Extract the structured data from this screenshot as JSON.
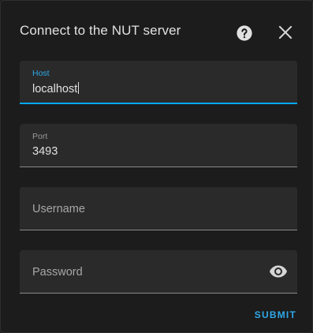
{
  "dialog": {
    "title": "Connect to the NUT server",
    "help_icon": "help-circle-icon",
    "close_icon": "close-icon"
  },
  "fields": {
    "host": {
      "label": "Host",
      "value": "localhost"
    },
    "port": {
      "label": "Port",
      "value": "3493"
    },
    "username": {
      "label": "Username",
      "value": ""
    },
    "password": {
      "label": "Password",
      "value": "",
      "toggle_icon": "eye-icon"
    }
  },
  "actions": {
    "submit_label": "SUBMIT"
  },
  "colors": {
    "accent": "#03a9f4",
    "background": "#1c1c1c",
    "field_background": "#2a2a2b"
  }
}
